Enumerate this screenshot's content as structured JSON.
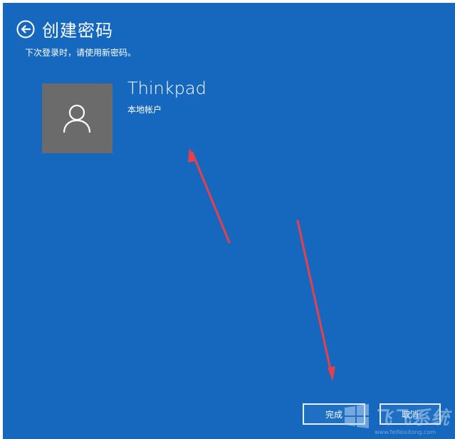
{
  "header": {
    "back_icon": "back-arrow-circle-icon",
    "title": "创建密码",
    "subtitle": "下次登录时，请使用新密码。"
  },
  "account": {
    "avatar_icon": "user-silhouette-icon",
    "name": "Thinkpad",
    "type": "本地帐户"
  },
  "buttons": {
    "finish_label": "完成",
    "cancel_label": "取消"
  },
  "watermark": {
    "text": "飞飞系统",
    "url": "www.feifeixitong.com"
  },
  "colors": {
    "background": "#1568bd",
    "avatar_bg": "#6b6b6b",
    "annotation_arrow": "#e8404a"
  }
}
